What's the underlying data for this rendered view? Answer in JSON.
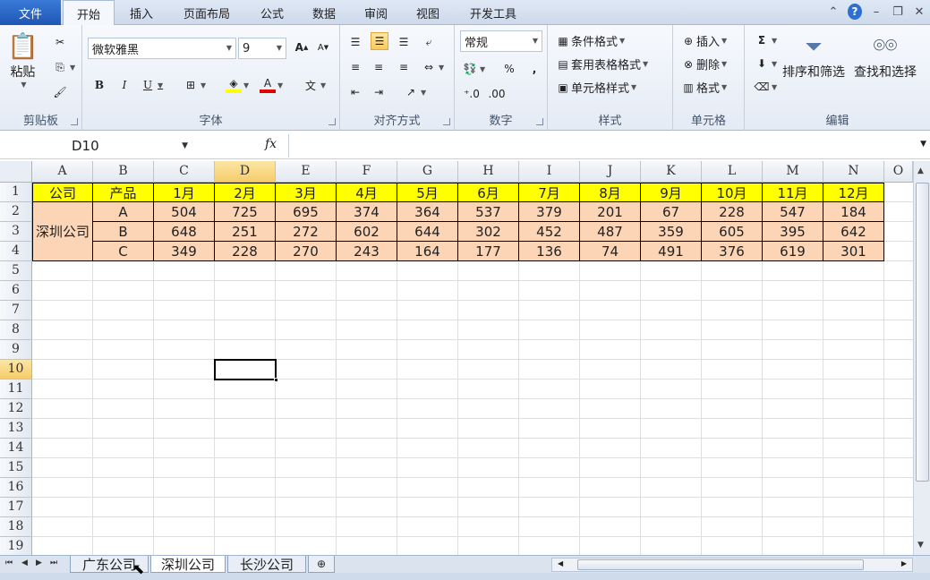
{
  "tabs": {
    "file": "文件",
    "items": [
      "开始",
      "插入",
      "页面布局",
      "公式",
      "数据",
      "审阅",
      "视图",
      "开发工具"
    ],
    "active": "开始"
  },
  "ribbon": {
    "clipboard": {
      "label": "剪贴板",
      "paste": "粘贴"
    },
    "font": {
      "label": "字体",
      "name": "微软雅黑",
      "size": "9"
    },
    "alignment": {
      "label": "对齐方式"
    },
    "number": {
      "label": "数字",
      "format": "常规",
      "percent": "%",
      "comma": ","
    },
    "styles": {
      "label": "样式",
      "conditional": "条件格式",
      "table": "套用表格格式",
      "cell": "单元格样式"
    },
    "cells": {
      "label": "单元格",
      "insert": "插入",
      "delete": "删除",
      "format": "格式"
    },
    "editing": {
      "label": "编辑",
      "sort": "排序和筛选",
      "find": "查找和选择"
    }
  },
  "formula_bar": {
    "name_box": "D10",
    "fx": "fx",
    "value": ""
  },
  "columns": [
    "A",
    "B",
    "C",
    "D",
    "E",
    "F",
    "G",
    "H",
    "I",
    "J",
    "K",
    "L",
    "M",
    "N",
    "O"
  ],
  "selected_column": "D",
  "rows": [
    "1",
    "2",
    "3",
    "4",
    "5",
    "6",
    "7",
    "8",
    "9",
    "10",
    "11",
    "12",
    "13",
    "14",
    "15",
    "16",
    "17",
    "18",
    "19"
  ],
  "selected_row": "10",
  "table": {
    "headers": [
      "公司",
      "产品",
      "1月",
      "2月",
      "3月",
      "4月",
      "5月",
      "6月",
      "7月",
      "8月",
      "9月",
      "10月",
      "11月",
      "12月"
    ],
    "company": "深圳公司",
    "products": [
      "A",
      "B",
      "C"
    ],
    "values": [
      [
        "504",
        "725",
        "695",
        "374",
        "364",
        "537",
        "379",
        "201",
        "67",
        "228",
        "547",
        "184"
      ],
      [
        "648",
        "251",
        "272",
        "602",
        "644",
        "302",
        "452",
        "487",
        "359",
        "605",
        "395",
        "642"
      ],
      [
        "349",
        "228",
        "270",
        "243",
        "164",
        "177",
        "136",
        "74",
        "491",
        "376",
        "619",
        "301"
      ]
    ]
  },
  "sheets": [
    "广东公司",
    "深圳公司",
    "长沙公司"
  ],
  "active_sheet": "深圳公司",
  "colors": {
    "header_fill": "#ffff00",
    "data_fill": "#fbd5b6",
    "file_tab": "#2a64c5"
  }
}
